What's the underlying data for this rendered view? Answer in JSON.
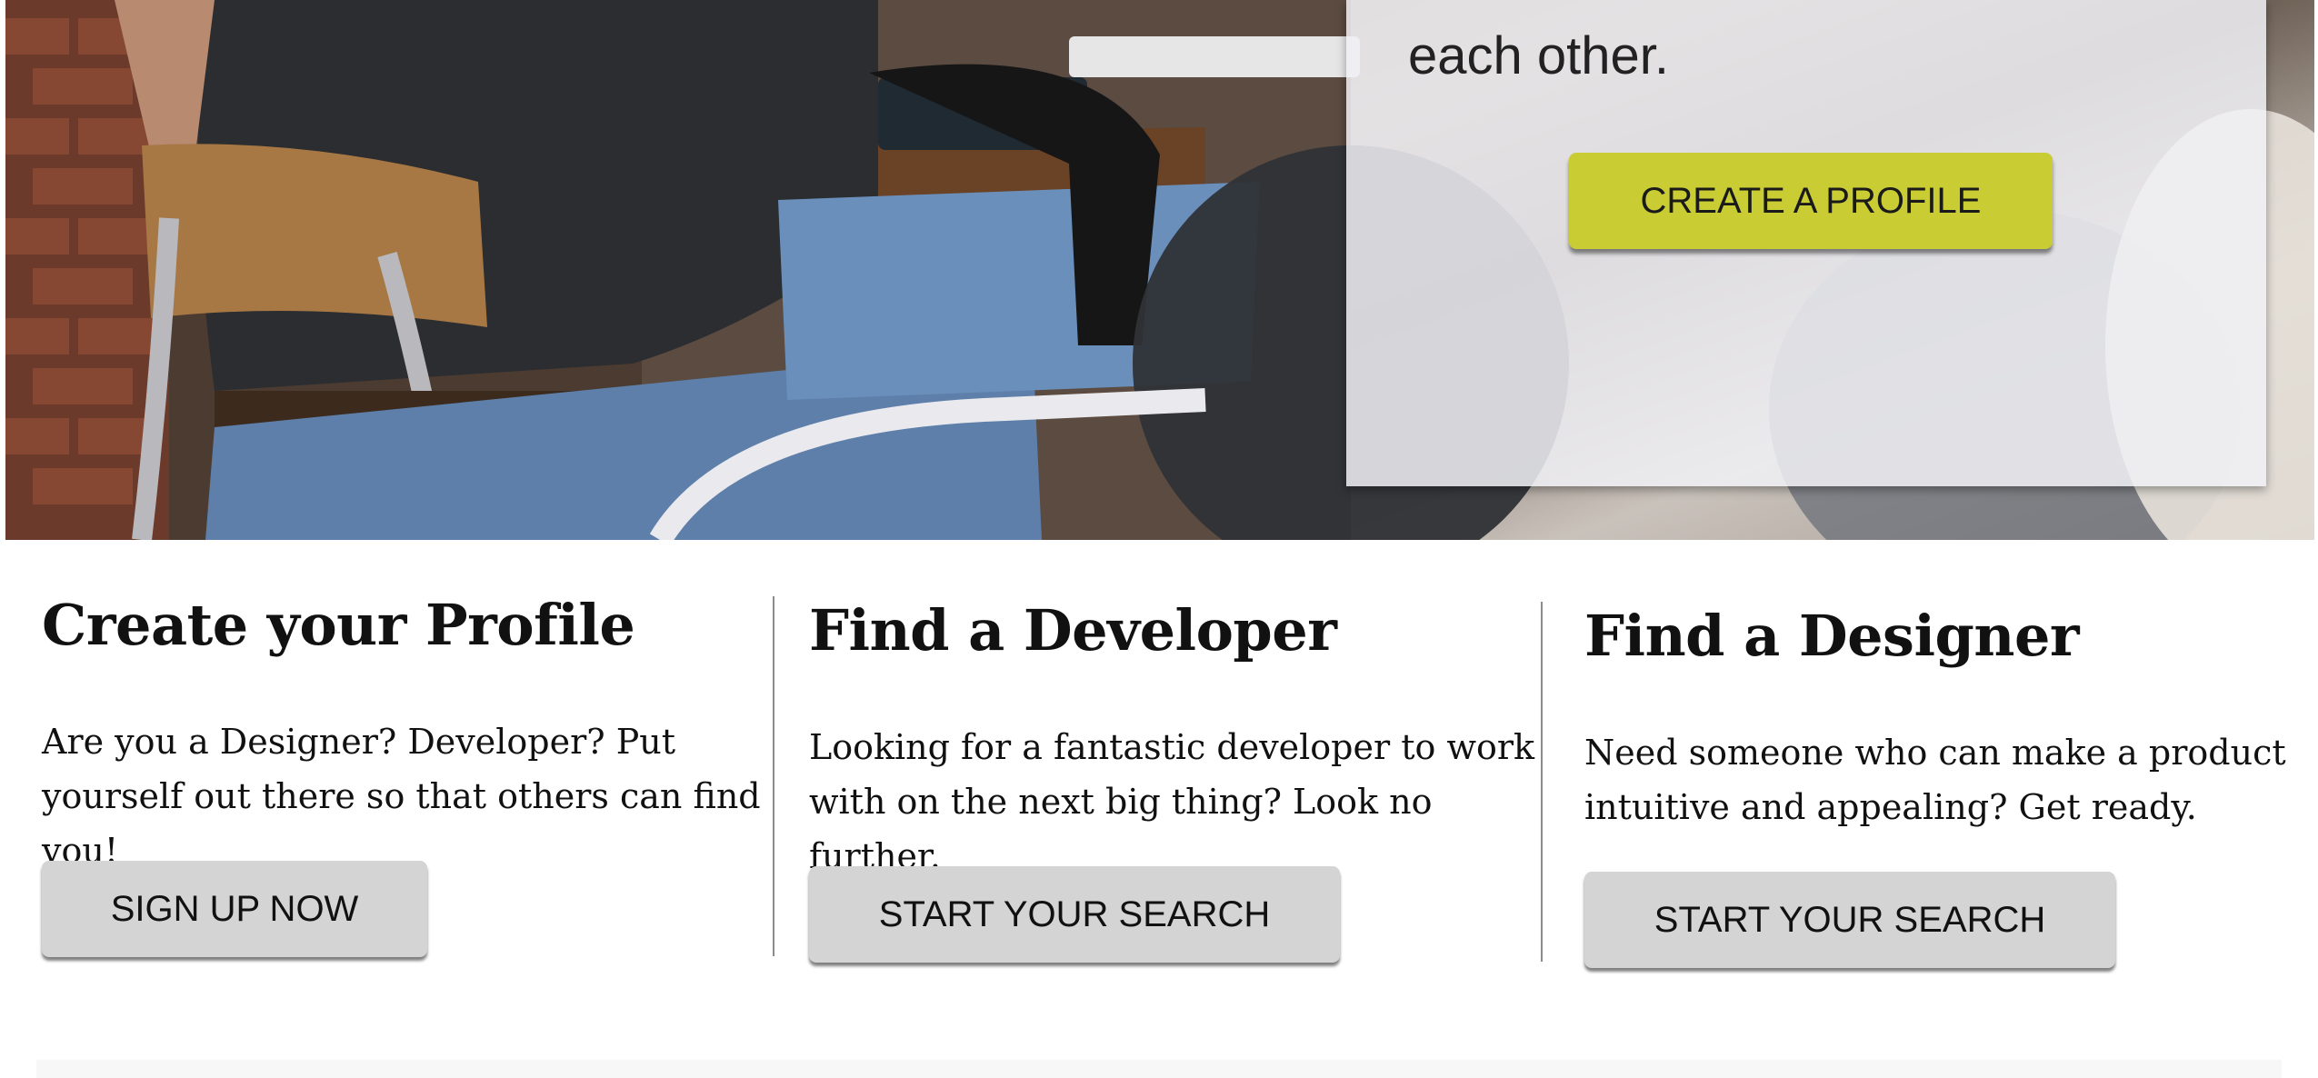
{
  "hero": {
    "headline_fragment": "each other.",
    "cta_label": "CREATE A PROFILE"
  },
  "features": [
    {
      "title": "Create your Profile",
      "description": "Are you a Designer? Developer? Put yourself out there so that others can find you!",
      "button_label": "SIGN UP NOW"
    },
    {
      "title": "Find a Developer",
      "description": "Looking for a fantastic developer to work with on the next big thing? Look no further.",
      "button_label": "START YOUR SEARCH"
    },
    {
      "title": "Find a Designer",
      "description": "Need someone who can make a product intuitive and appealing? Get ready.",
      "button_label": "START YOUR SEARCH"
    }
  ],
  "colors": {
    "cta_background": "#c9cc33",
    "button_background": "#d4d4d4",
    "divider": "#8c8c8c"
  }
}
